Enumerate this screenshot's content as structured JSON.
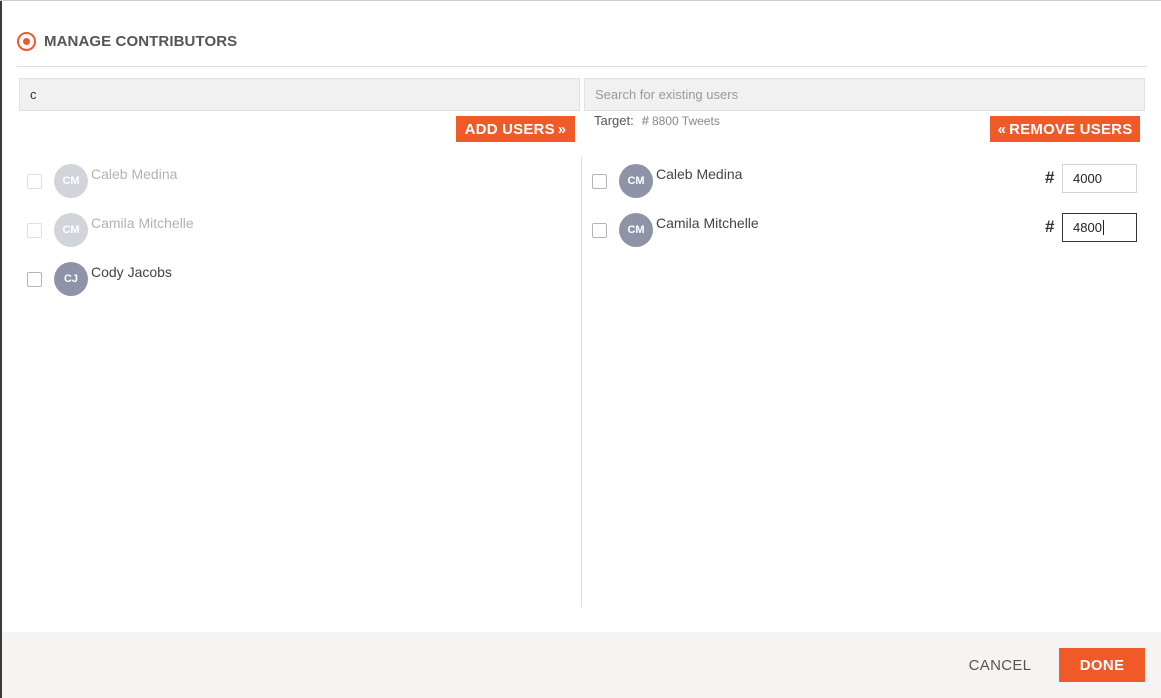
{
  "dialog": {
    "title": "MANAGE CONTRIBUTORS"
  },
  "left_panel": {
    "search_value": "c",
    "add_button_label": "ADD USERS",
    "add_button_icon": "»",
    "users": [
      {
        "initials": "CM",
        "name": "Caleb Medina",
        "state": "already-added"
      },
      {
        "initials": "CM",
        "name": "Camila Mitchelle",
        "state": "already-added"
      },
      {
        "initials": "CJ",
        "name": "Cody Jacobs",
        "state": "available"
      }
    ]
  },
  "right_panel": {
    "search_placeholder": "Search for existing users",
    "target_label": "Target:",
    "target_hash": "#",
    "target_value": "8800 Tweets",
    "remove_button_label": "REMOVE USERS",
    "remove_button_icon": "«",
    "hash_symbol": "#",
    "contributors": [
      {
        "initials": "CM",
        "name": "Caleb Medina",
        "amount": "4000"
      },
      {
        "initials": "CM",
        "name": "Camila Mitchelle",
        "amount": "4800"
      }
    ]
  },
  "footer": {
    "cancel_label": "CANCEL",
    "done_label": "DONE"
  },
  "colors": {
    "accent": "#f05a28",
    "avatar": "#8f93a8",
    "avatar_faded": "#d2d4dc"
  }
}
